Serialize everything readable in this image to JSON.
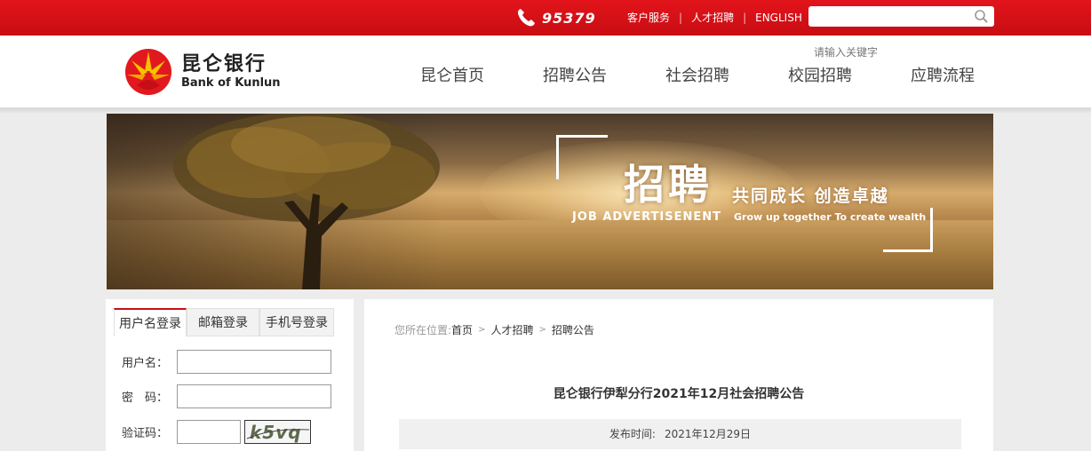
{
  "topbar": {
    "hotline": "95379",
    "links": [
      "客户服务",
      "人才招聘",
      "ENGLISH"
    ],
    "search_placeholder": ""
  },
  "header": {
    "logo_cn": "昆仑银行",
    "logo_en": "Bank of Kunlun",
    "search_hint": "请输入关键字",
    "nav": [
      "昆仑首页",
      "招聘公告",
      "社会招聘",
      "校园招聘",
      "应聘流程"
    ]
  },
  "banner": {
    "title": "招聘",
    "slogan": "共同成长  创造卓越",
    "en_title": "JOB  ADVERTISENENT",
    "en_slogan": "Grow up together To create wealth"
  },
  "login": {
    "tabs": [
      "用户名登录",
      "邮箱登录",
      "手机号登录"
    ],
    "active_tab": 0,
    "username_label": "用户名：",
    "password_label": "密　码：",
    "captcha_label": "验证码：",
    "captcha_text": "k5vq",
    "username_value": "",
    "password_value": "",
    "captcha_value": ""
  },
  "content": {
    "breadcrumb_prefix": "您所在位置:",
    "breadcrumb": [
      "首页",
      "人才招聘",
      "招聘公告"
    ],
    "article_title": "昆仑银行伊犁分行2021年12月社会招聘公告",
    "publish_label": "发布时间:",
    "publish_date": "2021年12月29日"
  },
  "colors": {
    "brand_red": "#d0111a",
    "logo_orange": "#f5a300",
    "active_tab_border": "#c40f15"
  }
}
